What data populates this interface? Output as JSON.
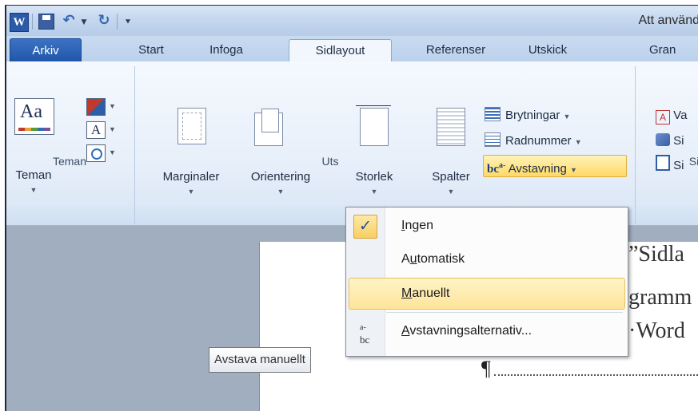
{
  "titlebar": {
    "app_icon_letter": "W",
    "title": "Att använd"
  },
  "tabs": [
    {
      "label": "Arkiv"
    },
    {
      "label": "Start"
    },
    {
      "label": "Infoga"
    },
    {
      "label": "Sidlayout"
    },
    {
      "label": "Referenser"
    },
    {
      "label": "Utskick"
    },
    {
      "label": "Gran"
    }
  ],
  "ribbon": {
    "teman": {
      "button_label": "Teman",
      "group_label": "Teman",
      "font_icon_letter": "A"
    },
    "page_setup": {
      "marginaler": "Marginaler",
      "orientering": "Orientering",
      "storlek": "Storlek",
      "spalter": "Spalter",
      "brytningar": "Brytningar",
      "radnummer": "Radnummer",
      "avstavning": "Avstavning",
      "avstavning_icon_text": "bc",
      "avstavning_icon_sup": "a-",
      "group_label": "Uts"
    },
    "right_partial": {
      "row1": "Va",
      "row2": "Si",
      "row3": "Si",
      "group_label": "Si"
    }
  },
  "dropdown": {
    "items": [
      {
        "label": "Ingen",
        "accel": "I",
        "rest": "ngen",
        "checked": true
      },
      {
        "label": "Automatisk",
        "pre": "A",
        "accel": "u",
        "rest": "tomatisk"
      },
      {
        "label": "Manuellt",
        "accel": "M",
        "rest": "anuellt",
        "selected": true
      },
      {
        "label": "Avstavningsalternativ...",
        "accel": "A",
        "rest": "vstavningsalternativ..."
      }
    ],
    "check_glyph": "✓",
    "hyphen_icon_text": "bc",
    "hyphen_icon_sup": "a-"
  },
  "tooltip": {
    "text": "Avstava manuellt"
  },
  "document": {
    "line1": "”Sidla",
    "line2": "gramm",
    "line3": "·Word",
    "pilcrow": "¶"
  }
}
